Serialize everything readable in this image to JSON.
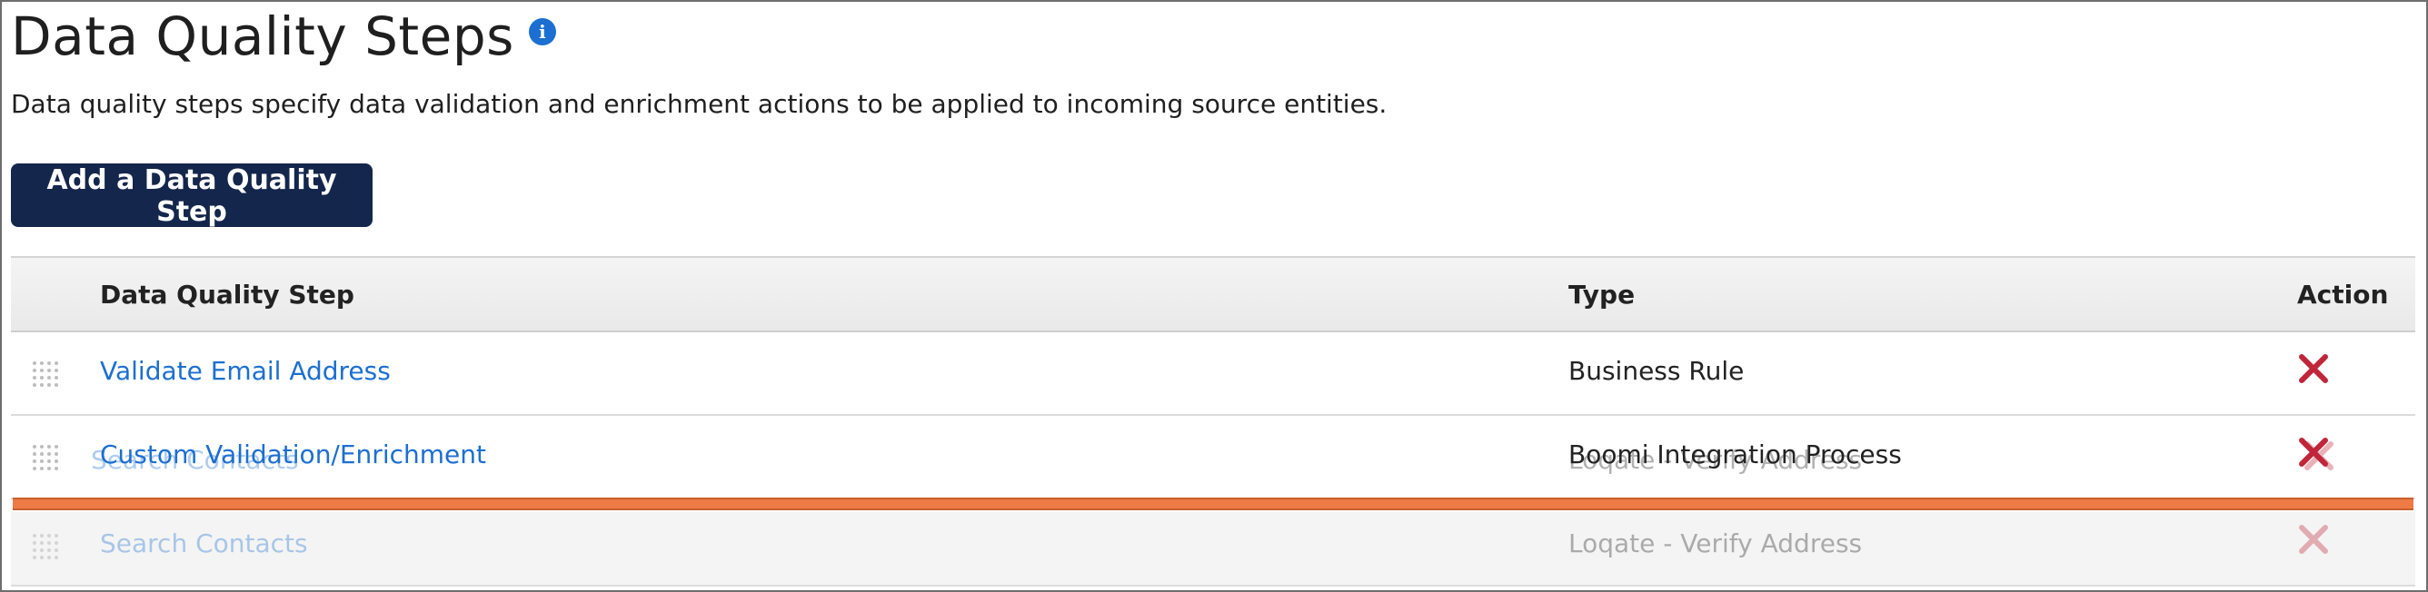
{
  "page": {
    "title": "Data Quality Steps",
    "description": "Data quality steps specify data validation and enrichment actions to be applied to incoming source entities.",
    "add_button_label": "Add a Data Quality Step"
  },
  "table": {
    "headers": {
      "step": "Data Quality Step",
      "type": "Type",
      "action": "Action"
    },
    "rows": [
      {
        "step": "Validate Email Address",
        "type": "Business Rule"
      },
      {
        "step": "Custom Validation/Enrichment",
        "type": "Boomi Integration Process"
      },
      {
        "step": "Search Contacts",
        "type": "Loqate - Verify Address"
      }
    ],
    "dragging": {
      "step": "Search Contacts",
      "type": "Loqate - Verify Address"
    }
  },
  "colors": {
    "button_bg": "#14264b",
    "link": "#1c6fd1",
    "delete": "#c0253a",
    "drop_indicator": "#ee7a46"
  },
  "icons": [
    "info-icon",
    "drag-handle-icon",
    "delete-icon"
  ]
}
